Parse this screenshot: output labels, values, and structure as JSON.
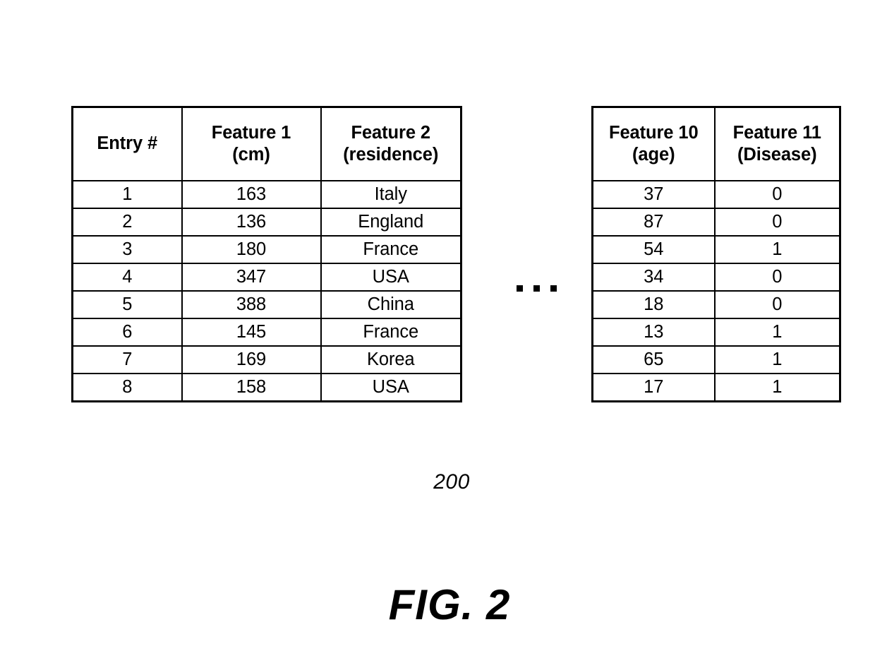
{
  "figure": {
    "caption": "FIG. 2",
    "reference_numeral": "200",
    "gap_ellipsis": "..."
  },
  "tables": {
    "left": {
      "name": "feature-table-left",
      "headers": [
        {
          "line1": "Entry #",
          "line2": ""
        },
        {
          "line1": "Feature 1",
          "line2": "(cm)"
        },
        {
          "line1": "Feature 2",
          "line2": "(residence)"
        }
      ],
      "rows": [
        {
          "entry": "1",
          "feature1": "163",
          "feature2": "Italy"
        },
        {
          "entry": "2",
          "feature1": "136",
          "feature2": "England"
        },
        {
          "entry": "3",
          "feature1": "180",
          "feature2": "France"
        },
        {
          "entry": "4",
          "feature1": "347",
          "feature2": "USA"
        },
        {
          "entry": "5",
          "feature1": "388",
          "feature2": "China"
        },
        {
          "entry": "6",
          "feature1": "145",
          "feature2": "France"
        },
        {
          "entry": "7",
          "feature1": "169",
          "feature2": "Korea"
        },
        {
          "entry": "8",
          "feature1": "158",
          "feature2": "USA"
        }
      ]
    },
    "right": {
      "name": "feature-table-right",
      "headers": [
        {
          "line1": "Feature 10",
          "line2": "(age)"
        },
        {
          "line1": "Feature 11",
          "line2": "(Disease)"
        }
      ],
      "rows": [
        {
          "feature10": "37",
          "feature11": "0"
        },
        {
          "feature10": "87",
          "feature11": "0"
        },
        {
          "feature10": "54",
          "feature11": "1"
        },
        {
          "feature10": "34",
          "feature11": "0"
        },
        {
          "feature10": "18",
          "feature11": "0"
        },
        {
          "feature10": "13",
          "feature11": "1"
        },
        {
          "feature10": "65",
          "feature11": "1"
        },
        {
          "feature10": "17",
          "feature11": "1"
        }
      ]
    }
  },
  "colors": {
    "ink": "#000000",
    "paper": "#ffffff"
  }
}
